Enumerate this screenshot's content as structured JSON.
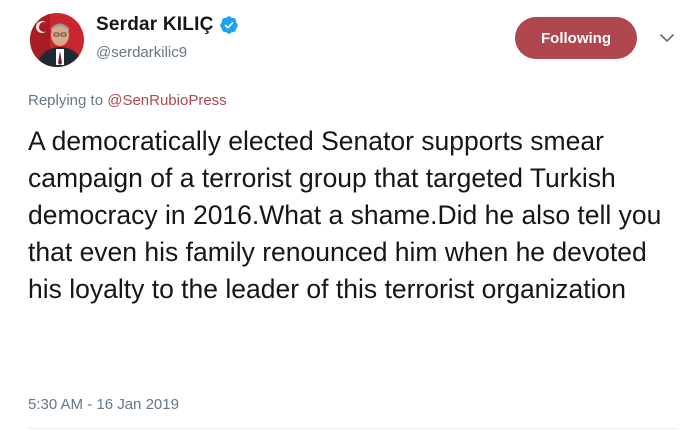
{
  "user": {
    "display_name": "Serdar KILIÇ",
    "handle": "@serdarkilic9",
    "verified": true,
    "avatar_icon": "profile-photo"
  },
  "follow_button": {
    "label": "Following",
    "color": "#b0474e"
  },
  "menu": {
    "icon": "chevron-down-icon"
  },
  "reply": {
    "prefix": "Replying to",
    "mention": "@SenRubioPress"
  },
  "tweet": {
    "text": "A democratically elected Senator supports smear campaign of a terrorist group that targeted Turkish democracy in 2016.What a shame.Did he also tell you that even his family renounced him when he devoted his loyalty to the leader of this terrorist organization",
    "timestamp": "5:30 AM - 16 Jan 2019"
  },
  "colors": {
    "accent": "#b0474e",
    "muted": "#657786",
    "text": "#14171a",
    "verified": "#1da1f2"
  }
}
